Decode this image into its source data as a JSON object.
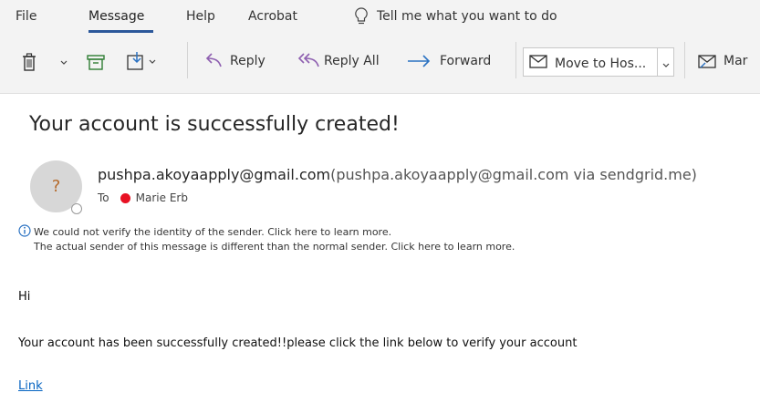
{
  "menu": {
    "items": [
      "File",
      "Message",
      "Help",
      "Acrobat"
    ],
    "tell_me": "Tell me what you want to do",
    "active": "Message"
  },
  "toolbar": {
    "reply": "Reply",
    "reply_all": "Reply All",
    "forward": "Forward",
    "move_to": "Move to Hos...",
    "mark": "Mar"
  },
  "message": {
    "subject": "Your account is successfully created!",
    "avatar_initial": "?",
    "sender_email": "pushpa.akoyaapply@gmail.com",
    "sender_via": "(pushpa.akoyaapply@gmail.com via sendgrid.me)",
    "to_label": "To",
    "recipient": "Marie Erb",
    "warning_line1": "We could not verify the identity of the sender. Click here to learn more.",
    "warning_line2": "The actual sender of this message is different than the normal sender. Click here to learn more.",
    "body_greeting": "Hi",
    "body_text": "Your account has been successfully created!!please click the link below to verify your account",
    "link_text": "Link"
  },
  "colors": {
    "accent": "#2b579a",
    "reply_icon": "#8e5fb0",
    "forward_icon": "#2b72c2",
    "presence_red": "#e81123",
    "link": "#0563c1"
  },
  "icons": [
    "lightbulb-icon",
    "delete-icon",
    "archive-icon",
    "move-icon",
    "reply-icon",
    "reply-all-icon",
    "forward-icon",
    "envelope-icon",
    "mark-icon",
    "info-icon"
  ]
}
